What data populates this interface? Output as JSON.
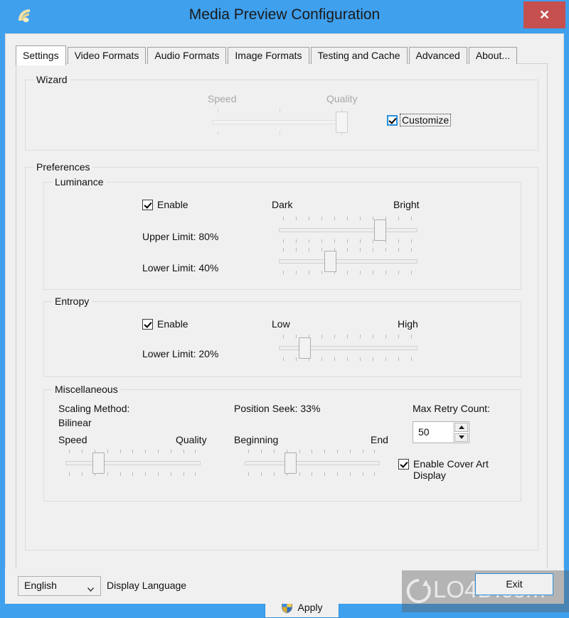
{
  "window": {
    "title": "Media Preview Configuration",
    "app_icon": "media-preview-icon",
    "close_label": "✕",
    "accent_color": "#3fa0ee",
    "close_color": "#c5504f"
  },
  "tabs": [
    {
      "label": "Settings",
      "active": true
    },
    {
      "label": "Video Formats",
      "active": false
    },
    {
      "label": "Audio Formats",
      "active": false
    },
    {
      "label": "Image Formats",
      "active": false
    },
    {
      "label": "Testing and Cache",
      "active": false
    },
    {
      "label": "Advanced",
      "active": false
    },
    {
      "label": "About...",
      "active": false
    }
  ],
  "wizard": {
    "legend": "Wizard",
    "slider_left_label": "Speed",
    "slider_right_label": "Quality",
    "slider_value_pct": 100,
    "slider_enabled": false,
    "tick_count": 3,
    "customize_label": "Customize",
    "customize_checked": true,
    "customize_focused": true
  },
  "preferences": {
    "legend": "Preferences",
    "luminance": {
      "legend": "Luminance",
      "enable_label": "Enable",
      "enable_checked": true,
      "left_label": "Dark",
      "right_label": "Bright",
      "tick_count": 11,
      "upper_limit_label": "Upper Limit: 80%",
      "upper_limit_pct": 80,
      "lower_limit_label": "Lower Limit: 40%",
      "lower_limit_pct": 40
    },
    "entropy": {
      "legend": "Entropy",
      "enable_label": "Enable",
      "enable_checked": true,
      "left_label": "Low",
      "right_label": "High",
      "tick_count": 11,
      "lower_limit_label": "Lower Limit: 20%",
      "lower_limit_pct": 20
    },
    "miscellaneous": {
      "legend": "Miscellaneous",
      "scaling_method_label": "Scaling Method:",
      "scaling_method_value": "Bilinear",
      "scaling_left_label": "Speed",
      "scaling_right_label": "Quality",
      "scaling_pct": 24,
      "scaling_tick_count": 11,
      "position_seek_label": "Position Seek: 33%",
      "position_seek_pct": 33,
      "position_left_label": "Beginning",
      "position_right_label": "End",
      "position_tick_count": 11,
      "max_retry_label": "Max Retry Count:",
      "max_retry_value": "50",
      "cover_art_label": "Enable Cover Art Display",
      "cover_art_checked": true
    }
  },
  "apply": {
    "label": "Apply",
    "icon": "uac-shield-icon"
  },
  "footer": {
    "language_value": "English",
    "language_caption": "Display Language",
    "exit_label": "Exit"
  },
  "watermark": {
    "text": "LO4D.com"
  }
}
